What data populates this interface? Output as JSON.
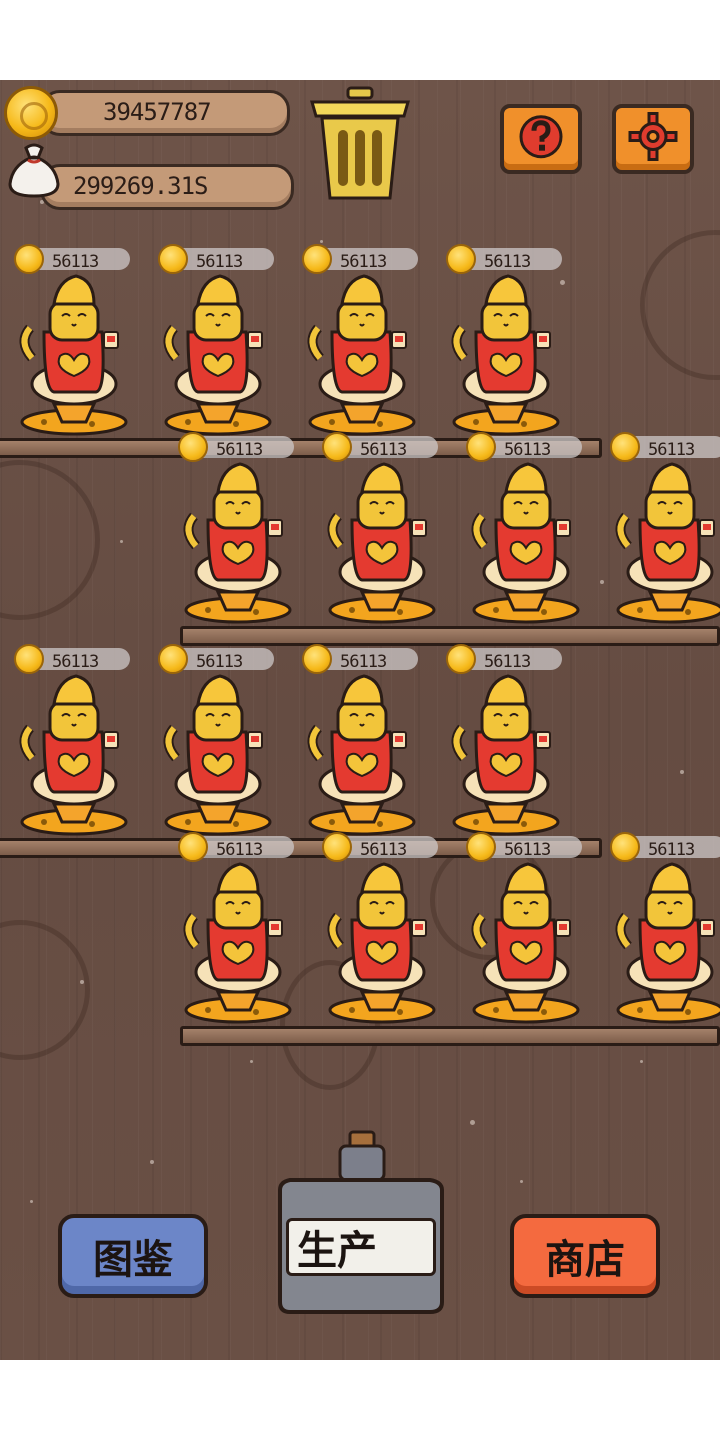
{
  "resources": {
    "coins": "39457787",
    "bag": "299269.31S"
  },
  "cats": [
    {
      "price": "56113"
    },
    {
      "price": "56113"
    },
    {
      "price": "56113"
    },
    {
      "price": "56113"
    },
    {
      "price": "56113"
    },
    {
      "price": "56113"
    },
    {
      "price": "56113"
    },
    {
      "price": "56113"
    },
    {
      "price": "56113"
    },
    {
      "price": "56113"
    },
    {
      "price": "56113"
    },
    {
      "price": "56113"
    },
    {
      "price": "56113"
    },
    {
      "price": "56113"
    },
    {
      "price": "56113"
    },
    {
      "price": "56113"
    }
  ],
  "buttons": {
    "collection": "图鉴",
    "produce": "生产",
    "shop": "商店"
  },
  "icons": {
    "coin": "coin-icon",
    "bag": "money-bag-icon",
    "trash": "trash-can-icon",
    "help": "question-icon",
    "settings": "gear-icon"
  },
  "colors": {
    "wood": "#6a5045",
    "orange_button": "#f0902b",
    "blue_button": "#6c86c8",
    "red_button": "#f46a3f",
    "coin": "#f6b919"
  }
}
